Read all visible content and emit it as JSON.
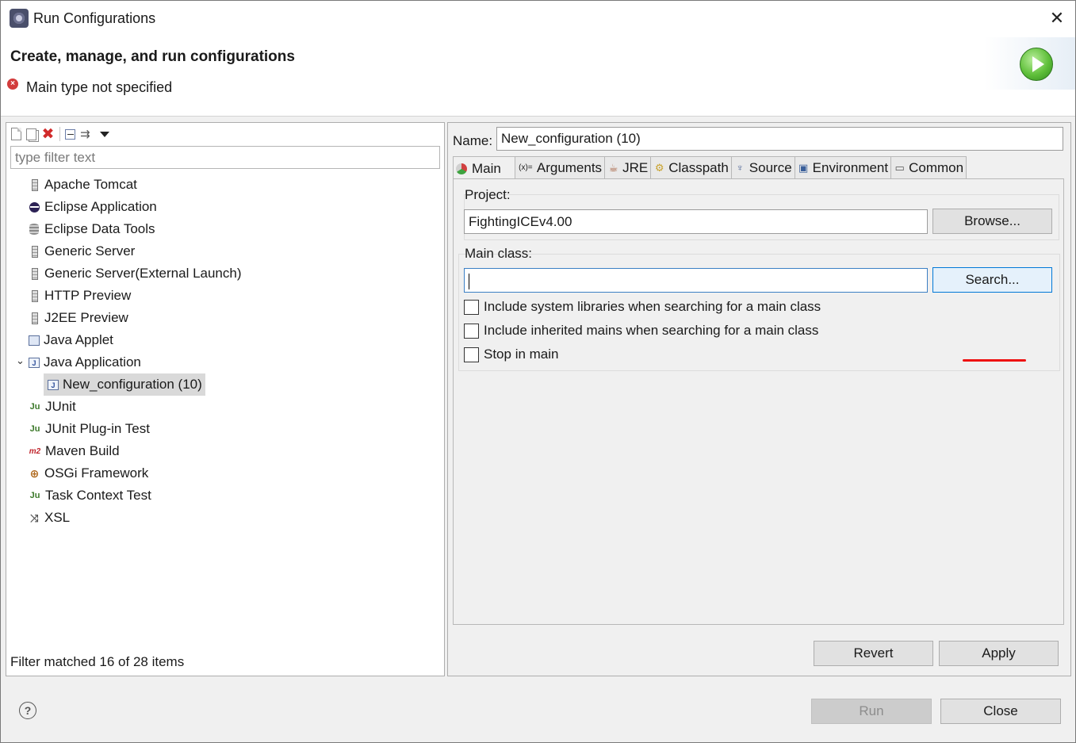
{
  "window": {
    "title": "Run Configurations",
    "close_glyph": "✕"
  },
  "banner": {
    "title": "Create, manage, and run configurations",
    "message": "Main type not specified",
    "error_icon": "error-icon",
    "run_icon": "run-icon"
  },
  "left": {
    "toolbar": {
      "new": "new-config-icon",
      "duplicate": "duplicate-icon",
      "delete": "delete-icon",
      "delete_glyph": "✖",
      "collapse": "collapse-all-icon",
      "filter": "filter-icon",
      "filter_glyph": "⇉",
      "menu": "view-menu-icon"
    },
    "filter_placeholder": "type filter text",
    "tree": [
      {
        "label": "Apache Tomcat",
        "icon": "server"
      },
      {
        "label": "Eclipse Application",
        "icon": "eclipse"
      },
      {
        "label": "Eclipse Data Tools",
        "icon": "db"
      },
      {
        "label": "Generic Server",
        "icon": "server"
      },
      {
        "label": "Generic Server(External Launch)",
        "icon": "server"
      },
      {
        "label": "HTTP Preview",
        "icon": "server"
      },
      {
        "label": "J2EE Preview",
        "icon": "server"
      },
      {
        "label": "Java Applet",
        "icon": "applet"
      },
      {
        "label": "Java Application",
        "icon": "japp",
        "expanded": true
      },
      {
        "label": "New_configuration (10)",
        "icon": "japp",
        "child": true,
        "selected": true
      },
      {
        "label": "JUnit",
        "icon": "junit"
      },
      {
        "label": "JUnit Plug-in Test",
        "icon": "junit"
      },
      {
        "label": "Maven Build",
        "icon": "m2"
      },
      {
        "label": "OSGi Framework",
        "icon": "osgi"
      },
      {
        "label": "Task Context Test",
        "icon": "junit"
      },
      {
        "label": "XSL",
        "icon": "xsl"
      }
    ],
    "icon_glyphs": {
      "junit": "Ju",
      "m2": "m2",
      "osgi": "⊕",
      "xsl": "⤨",
      "japp": "J"
    },
    "expand_glyph": "⌄",
    "status": "Filter matched 16 of 28 items"
  },
  "right": {
    "name_label": "Name:",
    "name_value": "New_configuration (10)",
    "tabs": [
      {
        "label": "Main",
        "icon": "main-tab-icon",
        "active": true
      },
      {
        "label": "Arguments",
        "icon": "arguments-icon",
        "glyph": "(x)="
      },
      {
        "label": "JRE",
        "icon": "jre-icon",
        "glyph": "☕"
      },
      {
        "label": "Classpath",
        "icon": "classpath-icon",
        "glyph": "⚙"
      },
      {
        "label": "Source",
        "icon": "source-icon",
        "glyph": "♆"
      },
      {
        "label": "Environment",
        "icon": "environment-icon",
        "glyph": "▣"
      },
      {
        "label": "Common",
        "icon": "common-icon",
        "glyph": "▭"
      }
    ],
    "project": {
      "label": "Project:",
      "value": "FightingICEv4.00",
      "button": "Browse..."
    },
    "main_class": {
      "label": "Main class:",
      "value": "",
      "button": "Search..."
    },
    "options": [
      {
        "label": "Include system libraries when searching for a main class",
        "checked": false
      },
      {
        "label": "Include inherited mains when searching for a main class",
        "checked": false
      },
      {
        "label": "Stop in main",
        "checked": false
      }
    ],
    "revert": "Revert",
    "apply": "Apply"
  },
  "footer": {
    "help_glyph": "?",
    "run": "Run",
    "close": "Close"
  },
  "colors": {
    "annotation": "#ee1111",
    "accent": "#0078d7",
    "error": "#d23c3c"
  }
}
